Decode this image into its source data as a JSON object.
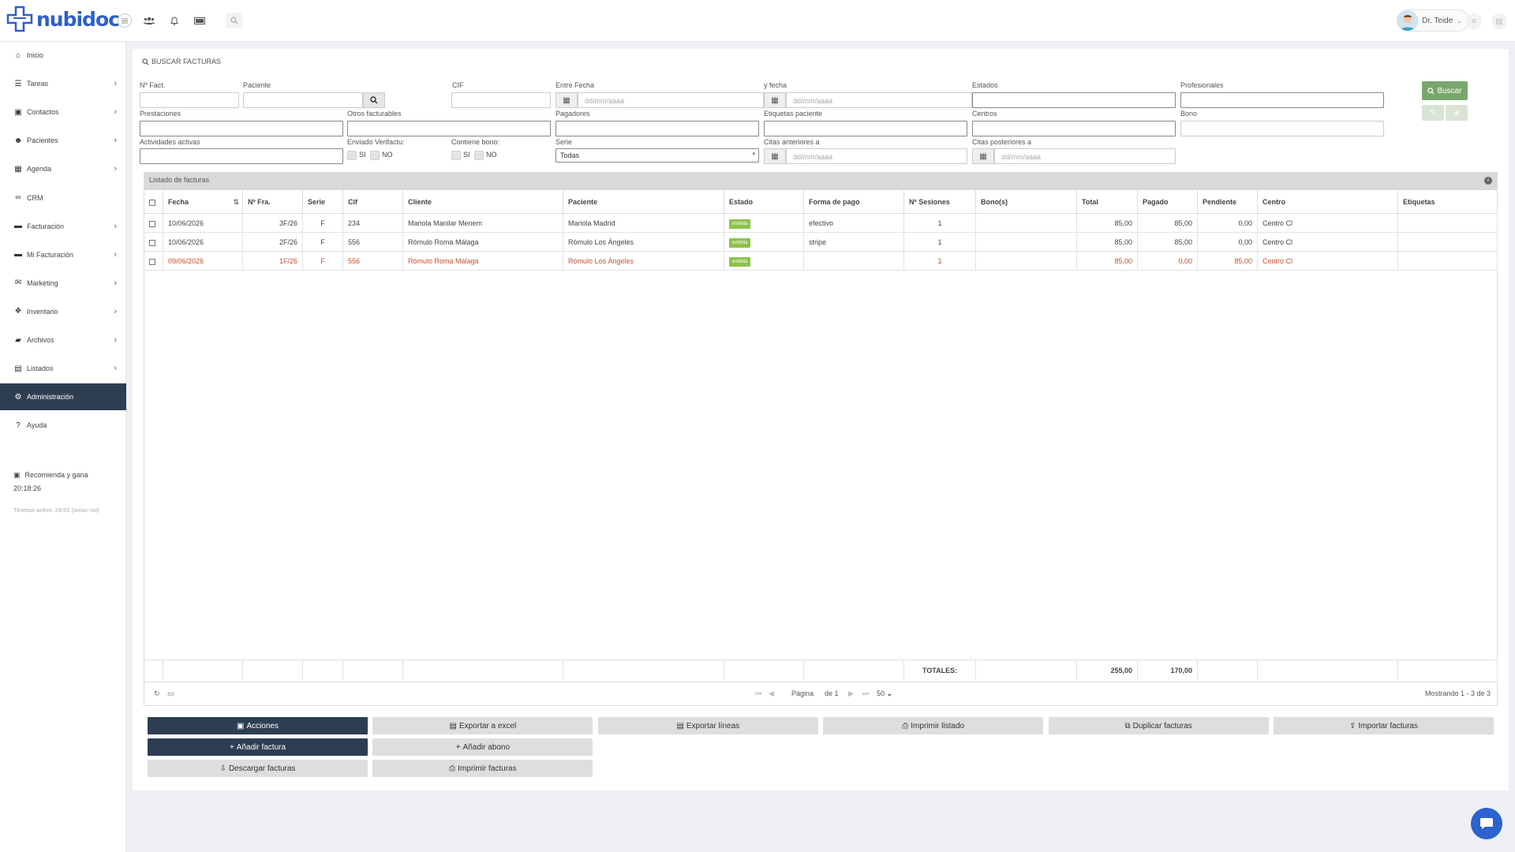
{
  "app": {
    "logo": "nubidoc",
    "user": "Dr. Teide"
  },
  "icons": {
    "contacts": "users-icon",
    "bell": "bell-icon",
    "cash": "money-icon",
    "search": "search-icon"
  },
  "sidebar": {
    "items": [
      {
        "label": "Inicio",
        "icon": "home-icon",
        "chevron": false
      },
      {
        "label": "Tareas",
        "icon": "list-icon",
        "chevron": true
      },
      {
        "label": "Contactos",
        "icon": "address-book-icon",
        "chevron": true
      },
      {
        "label": "Pacientes",
        "icon": "users-icon",
        "chevron": true
      },
      {
        "label": "Agenda",
        "icon": "calendar-icon",
        "chevron": true
      },
      {
        "label": "CRM",
        "icon": "handshake-icon",
        "chevron": false
      },
      {
        "label": "Facturación",
        "icon": "money-icon",
        "chevron": true
      },
      {
        "label": "Mi Facturación",
        "icon": "money-icon",
        "chevron": true
      },
      {
        "label": "Marketing",
        "icon": "envelope-icon",
        "chevron": true
      },
      {
        "label": "Inventario",
        "icon": "cubes-icon",
        "chevron": true
      },
      {
        "label": "Archivos",
        "icon": "folder-icon",
        "chevron": true
      },
      {
        "label": "Listados",
        "icon": "chart-icon",
        "chevron": true
      },
      {
        "label": "Administración",
        "icon": "gear-icon",
        "chevron": false,
        "active": true
      },
      {
        "label": "Ayuda",
        "icon": "question-icon",
        "chevron": false
      }
    ],
    "referral": "Recomienda y gana",
    "clock": "20:18:26",
    "timeout": "Timeout activo: 29:51 (aviso: no)"
  },
  "search": {
    "title": "BUSCAR FACTURAS",
    "labels": {
      "nfact": "Nº Fact.",
      "paciente": "Paciente",
      "cif": "CIF",
      "entre_fecha": "Entre Fecha",
      "y_fecha": "y fecha",
      "estados": "Estados",
      "profesionales": "Profesionales",
      "prestaciones": "Prestaciones",
      "otros": "Otros facturables",
      "pagadores": "Pagadores",
      "etiquetas": "Etiquetas paciente",
      "centros": "Centros",
      "bono": "Bono",
      "actividades": "Actividades activas",
      "verifactu": "Enviado Verifactu:",
      "contiene_bono": "Contiene bono:",
      "serie": "Serie",
      "citas_ant": "Citas anteriores a",
      "citas_post": "Citas posteriores a"
    },
    "date_placeholder": "dd/mm/aaaa",
    "si": "SI",
    "no": "NO",
    "serie_value": "Todas",
    "buscar": "Buscar"
  },
  "grid": {
    "caption": "Listado de facturas",
    "columns": [
      "Fecha",
      "Nº Fra.",
      "Serie",
      "Cif",
      "Cliente",
      "Paciente",
      "Estado",
      "Forma de pago",
      "Nº Sesiones",
      "Bono(s)",
      "Total",
      "Pagado",
      "Pendiente",
      "Centro",
      "Etiquetas"
    ],
    "rows": [
      {
        "fecha": "10/06/2026",
        "nfra": "3F/26",
        "serie": "F",
        "cif": "234",
        "cliente": "Mariola Manilar Menem",
        "paciente": "Mariola Madrid",
        "estado": "emitida",
        "pago": "efectivo",
        "sesiones": "1",
        "bono": "",
        "total": "85,00",
        "pagado": "85,00",
        "pendiente": "0,00",
        "centro": "Centro Cl",
        "etiquetas": ""
      },
      {
        "fecha": "10/06/2026",
        "nfra": "2F/26",
        "serie": "F",
        "cif": "556",
        "cliente": "Rómulo Roma Málaga",
        "paciente": "Rómulo Los Ángeles",
        "estado": "emitida",
        "pago": "stripe",
        "sesiones": "1",
        "bono": "",
        "total": "85,00",
        "pagado": "85,00",
        "pendiente": "0,00",
        "centro": "Centro Cl",
        "etiquetas": ""
      },
      {
        "fecha": "09/06/2026",
        "nfra": "1F/26",
        "serie": "F",
        "cif": "556",
        "cliente": "Rómulo Roma Málaga",
        "paciente": "Rómulo Los Ángeles",
        "estado": "emitida",
        "pago": "",
        "sesiones": "1",
        "bono": "",
        "total": "85,00",
        "pagado": "0,00",
        "pendiente": "85,00",
        "centro": "Centro Cl",
        "etiquetas": "",
        "highlight": true
      }
    ],
    "totals": {
      "label": "TOTALES:",
      "total": "255,00",
      "pagado": "170,00"
    },
    "pager": {
      "pagina": "Página",
      "de": "de 1",
      "per_page": "50",
      "showing": "Mostrando 1 - 3 de 3"
    }
  },
  "actions": {
    "acciones": "Acciones",
    "exportar_excel": "Exportar a excel",
    "exportar_lineas": "Exportar líneas",
    "imprimir_listado": "Imprimir listado",
    "duplicar": "Duplicar facturas",
    "importar": "Importar facturas",
    "anadir_factura": "Añadir factura",
    "anadir_abono": "Añadir abono",
    "descargar": "Descargar facturas",
    "imprimir_facturas": "Imprimir facturas"
  },
  "colors": {
    "primary": "#2d3e52",
    "success": "#7aa76e",
    "badge": "#8bc34a",
    "highlight": "#c5502b",
    "brand": "#2e5fc9"
  }
}
